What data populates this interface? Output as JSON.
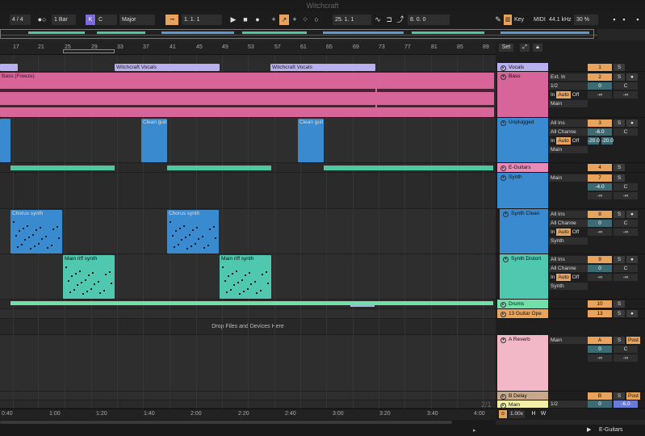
{
  "window": {
    "title": "Witchcraft"
  },
  "transport": {
    "time_sig": "4 / 4",
    "quantize": "1 Bar",
    "key_root": "C",
    "scale": "Major",
    "position": "1.   1.   1",
    "loop_start": "25.   1.   1",
    "loop_length": "8.   0.   0",
    "key_label": "Key",
    "midi_label": "MIDI",
    "sample_rate": "44.1 kHz",
    "cpu": "30 %"
  },
  "ruler": {
    "set_label": "Set",
    "bars": [
      "17",
      "21",
      "25",
      "29",
      "33",
      "37",
      "41",
      "45",
      "49",
      "53",
      "57",
      "61",
      "65",
      "69",
      "73",
      "77",
      "81",
      "85",
      "89"
    ]
  },
  "time_marks": [
    "0:40",
    "1:00",
    "1:20",
    "1:40",
    "2:00",
    "2:20",
    "2:40",
    "3:00",
    "3:20",
    "3:40",
    "4:00"
  ],
  "page_indicator": "2/1",
  "drop_hint": "Drop Files and Devices Here",
  "clips": {
    "vocals_1": "Witchcraft Vocals",
    "vocals_2": "Witchcraft Vocals",
    "bass": "Bass (Freeze)",
    "clean_1": "Clean guit",
    "clean_2": "Clean guit",
    "chorus_1": "Chorus synth",
    "chorus_2": "Chorus synth",
    "riff_1": "Main riff synth",
    "riff_2": "Main riff synth"
  },
  "tracks": [
    {
      "name": "Vocals",
      "num": "1",
      "color": "#b9b0f0"
    },
    {
      "name": "Bass",
      "num": "2",
      "color": "#d8659a",
      "input": "Ext. In",
      "channel": "1/2",
      "output": "Main",
      "vol": "0",
      "pan": "C",
      "send_a": "-∞",
      "send_b": "-∞"
    },
    {
      "name": "Unplugged",
      "num": "3",
      "color": "#3a8ad0",
      "input": "All Ins",
      "channel": "All Channe",
      "output": "Main",
      "vol": "-6.0",
      "pan": "C",
      "send_a": "-20.0",
      "send_b": "-20.0"
    },
    {
      "name": "E-Guitars",
      "num": "4",
      "color": "#e88bb7"
    },
    {
      "name": "Synth",
      "num": "7",
      "color": "#3a8ad0",
      "output": "Main",
      "vol": "-4.0",
      "pan": "C",
      "send_a": "-∞",
      "send_b": "-∞"
    },
    {
      "name": "Synth Clean",
      "num": "8",
      "color": "#3a8ad0",
      "input": "All Ins",
      "channel": "All Channe",
      "output": "Synth",
      "vol": "0",
      "pan": "C",
      "send_a": "-∞",
      "send_b": "-∞"
    },
    {
      "name": "Synth Distort",
      "num": "9",
      "color": "#50c8b0",
      "input": "All Ins",
      "channel": "All Channe",
      "output": "Synth",
      "vol": "0",
      "pan": "C",
      "send_a": "-∞",
      "send_b": "-∞"
    },
    {
      "name": "Drums",
      "num": "10",
      "color": "#70e0a8"
    },
    {
      "name": "13 Guitar Ope",
      "num": "13",
      "color": "#e8a45c"
    },
    {
      "name": "A Reverb",
      "num": "A",
      "color": "#f2b8c8",
      "output": "Main",
      "vol": "0",
      "pan": "C",
      "post": "Post",
      "send_a": "-∞",
      "send_b": "-∞"
    },
    {
      "name": "B Delay",
      "num": "B",
      "color": "#c8a888",
      "post": "Post"
    },
    {
      "name": "Main",
      "num": "0",
      "color": "#f2f0a8",
      "channel": "1/2",
      "vol": "-6.0"
    }
  ],
  "monitor": {
    "in": "In",
    "auto": "Auto",
    "off": "Off"
  },
  "mixer": {
    "solo": "S",
    "rec": "●",
    "cue_time": "1.00x",
    "h": "H",
    "w": "W"
  },
  "status": {
    "track": "E-Guitars"
  }
}
